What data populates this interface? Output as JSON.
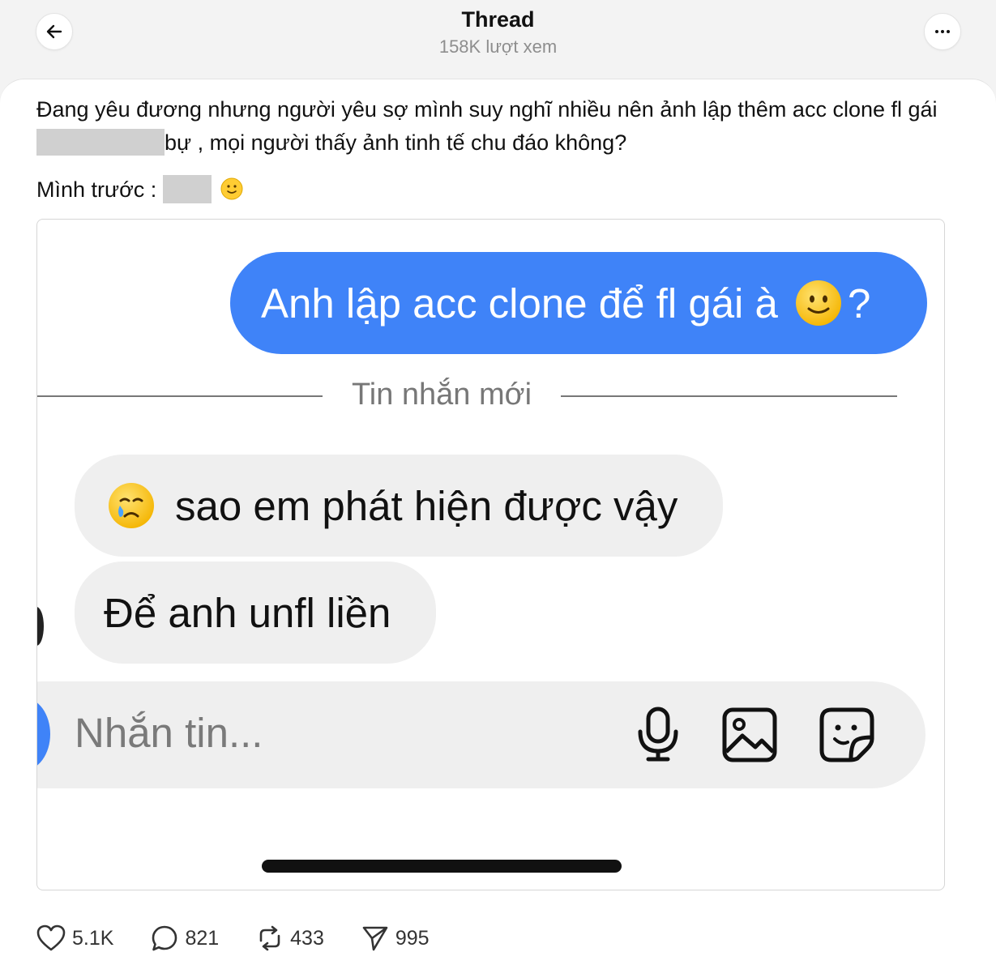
{
  "header": {
    "title": "Thread",
    "subtitle": "158K lượt xem",
    "back_icon": "arrow-left-icon",
    "more_icon": "more-horizontal-icon"
  },
  "post": {
    "text_part1": "Đang yêu đương nhưng người yêu sợ mình suy nghĩ nhiều nên ảnh lập thêm acc clone fl gái ",
    "text_part2": "bự , mọi người thấy ảnh tinh tế chu đáo không?",
    "line2_prefix": "Mình trước :",
    "line2_emoji": "slightly-smiling-face-icon"
  },
  "chat": {
    "outgoing_message": "Anh lập acc clone để fl gái à",
    "outgoing_suffix": "?",
    "divider_label": "Tin nhắn mới",
    "incoming_messages": [
      {
        "text": "sao em phát hiện được vậy",
        "emoji": "crying-face-icon"
      },
      {
        "text": "Để anh unfl liền"
      }
    ],
    "composer_placeholder": "Nhắn tin...",
    "composer_icons": [
      "microphone-icon",
      "gallery-icon",
      "sticker-icon"
    ]
  },
  "actions": {
    "likes": "5.1K",
    "comments": "821",
    "reposts": "433",
    "shares": "995"
  },
  "colors": {
    "outgoing_bubble": "#3f83f8",
    "incoming_bubble": "#efefef",
    "emoji_yellow": "#ffcc33"
  }
}
